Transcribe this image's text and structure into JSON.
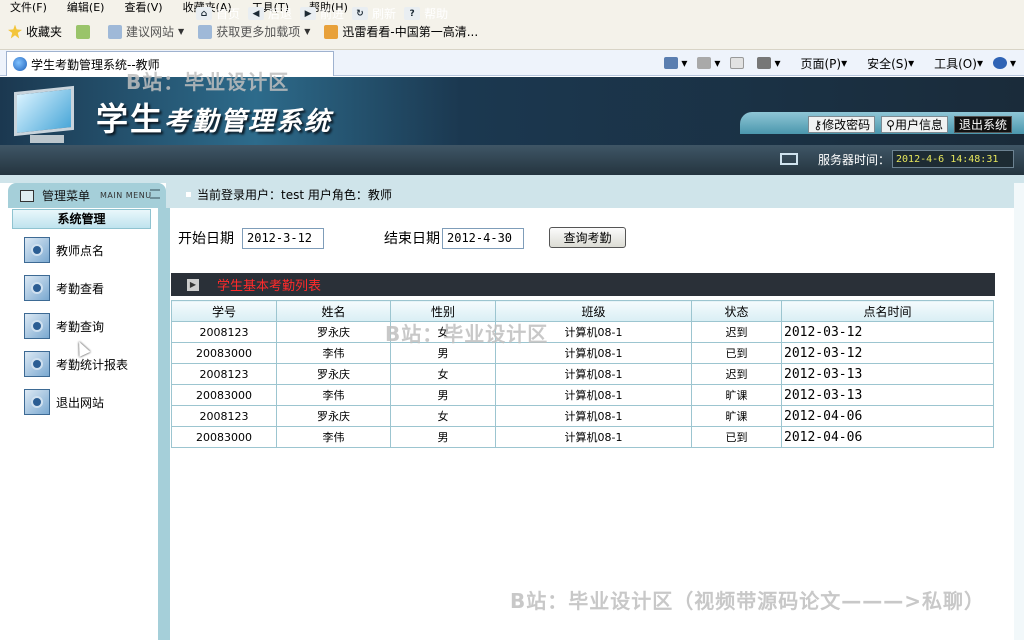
{
  "browser": {
    "menu": [
      "文件(F)",
      "编辑(E)",
      "查看(V)",
      "收藏夹(A)",
      "工具(T)",
      "帮助(H)"
    ],
    "favorites_label": "收藏夹",
    "fav_links": [
      "建议网站",
      "获取更多加载项",
      "迅雷看看-中国第一高清..."
    ],
    "tab_title": "学生考勤管理系统--教师",
    "toolbar": [
      "页面(P)",
      "安全(S)",
      "工具(O)"
    ]
  },
  "header": {
    "title_a": "学生",
    "title_b": "考勤管理系统",
    "buttons": [
      "修改密码",
      "用户信息",
      "退出系统"
    ]
  },
  "nav": {
    "items": [
      "首页",
      "后退",
      "前进",
      "刷新",
      "帮助"
    ],
    "server_label": "服务器时间：",
    "server_time": "2012-4-6 14:48:31"
  },
  "sidebar": {
    "title": "管理菜单",
    "title_en": "MAIN MENU",
    "section": "系统管理",
    "items": [
      "教师点名",
      "考勤查看",
      "考勤查询",
      "考勤统计报表",
      "退出网站"
    ]
  },
  "main": {
    "login_info": "当前登录用户：test  用户角色：教师",
    "start_label": "开始日期",
    "start_value": "2012-3-12",
    "end_label": "结束日期",
    "end_value": "2012-4-30",
    "query_button": "查询考勤",
    "list_title": "学生基本考勤列表",
    "columns": [
      "学号",
      "姓名",
      "性别",
      "班级",
      "状态",
      "点名时间"
    ],
    "rows": [
      [
        "2008123",
        "罗永庆",
        "女",
        "计算机08-1",
        "迟到",
        "2012-03-12"
      ],
      [
        "20083000",
        "李伟",
        "男",
        "计算机08-1",
        "已到",
        "2012-03-12"
      ],
      [
        "2008123",
        "罗永庆",
        "女",
        "计算机08-1",
        "迟到",
        "2012-03-13"
      ],
      [
        "20083000",
        "李伟",
        "男",
        "计算机08-1",
        "旷课",
        "2012-03-13"
      ],
      [
        "2008123",
        "罗永庆",
        "女",
        "计算机08-1",
        "旷课",
        "2012-04-06"
      ],
      [
        "20083000",
        "李伟",
        "男",
        "计算机08-1",
        "已到",
        "2012-04-06"
      ]
    ]
  },
  "watermarks": {
    "w1": "B站：毕业设计区",
    "w2": "B站：毕业设计区",
    "w3": "B站：毕业设计区（视频带源码论文———>私聊）"
  }
}
